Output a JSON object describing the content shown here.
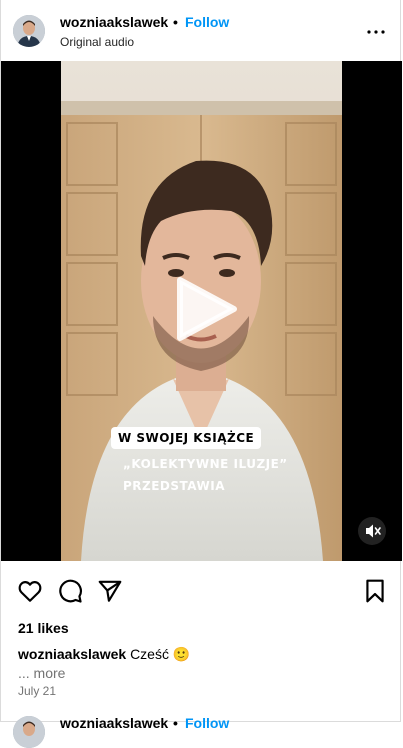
{
  "post": {
    "username": "wozniaakslawek",
    "separator": "•",
    "follow_label": "Follow",
    "audio_label": "Original audio",
    "more_options_icon": "more-horizontal-icon"
  },
  "video": {
    "overlay_lines": [
      "W SWOJEJ KSIĄŻCE",
      "„KOLEKTYWNE ILUZJE”",
      "PRZEDSTAWIA"
    ],
    "play_icon": "play-icon",
    "mute_icon": "speaker-muted-icon"
  },
  "actions": {
    "like_icon": "heart-icon",
    "comment_icon": "comment-icon",
    "share_icon": "send-icon",
    "save_icon": "bookmark-icon"
  },
  "likes_text": "21 likes",
  "caption": {
    "username": "wozniaakslawek",
    "text": "Cześć 🙂",
    "more_label": "... more"
  },
  "date": "July 21",
  "next_post": {
    "username": "wozniaakslawek",
    "separator": "•",
    "follow_label": "Follow"
  },
  "colors": {
    "follow_blue": "#0095f6",
    "secondary_text": "#737373",
    "border": "#dbdbdb"
  }
}
